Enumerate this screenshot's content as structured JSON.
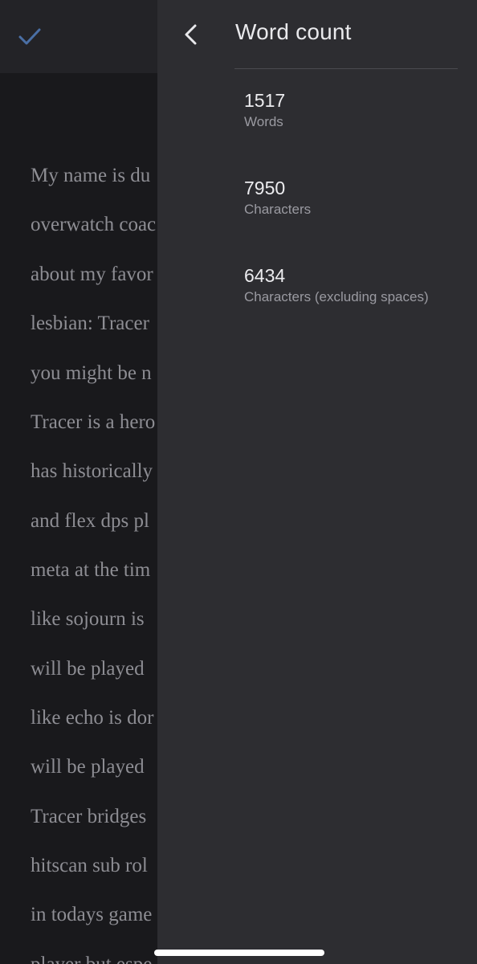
{
  "document": {
    "lines": [
      "My name is du",
      "overwatch coac",
      "about my favor",
      "lesbian: Tracer",
      "you might be n",
      "Tracer is a hero",
      "has historically",
      "and flex dps pl",
      "meta at the tim",
      "like sojourn is",
      "will be played",
      "like echo is dor",
      "will be played",
      "Tracer bridges",
      "hitscan sub rol",
      "in todays game",
      "player but espe"
    ]
  },
  "panel": {
    "title": "Word count",
    "stats": [
      {
        "value": "1517",
        "label": "Words"
      },
      {
        "value": "7950",
        "label": "Characters"
      },
      {
        "value": "6434",
        "label": "Characters (excluding spaces)"
      }
    ]
  },
  "colors": {
    "accent": "#4a6fa5",
    "panel_bg": "#2d2d31",
    "doc_bg": "#19191c"
  },
  "icons": {
    "done": "check-icon",
    "back": "chevron-left-icon"
  }
}
